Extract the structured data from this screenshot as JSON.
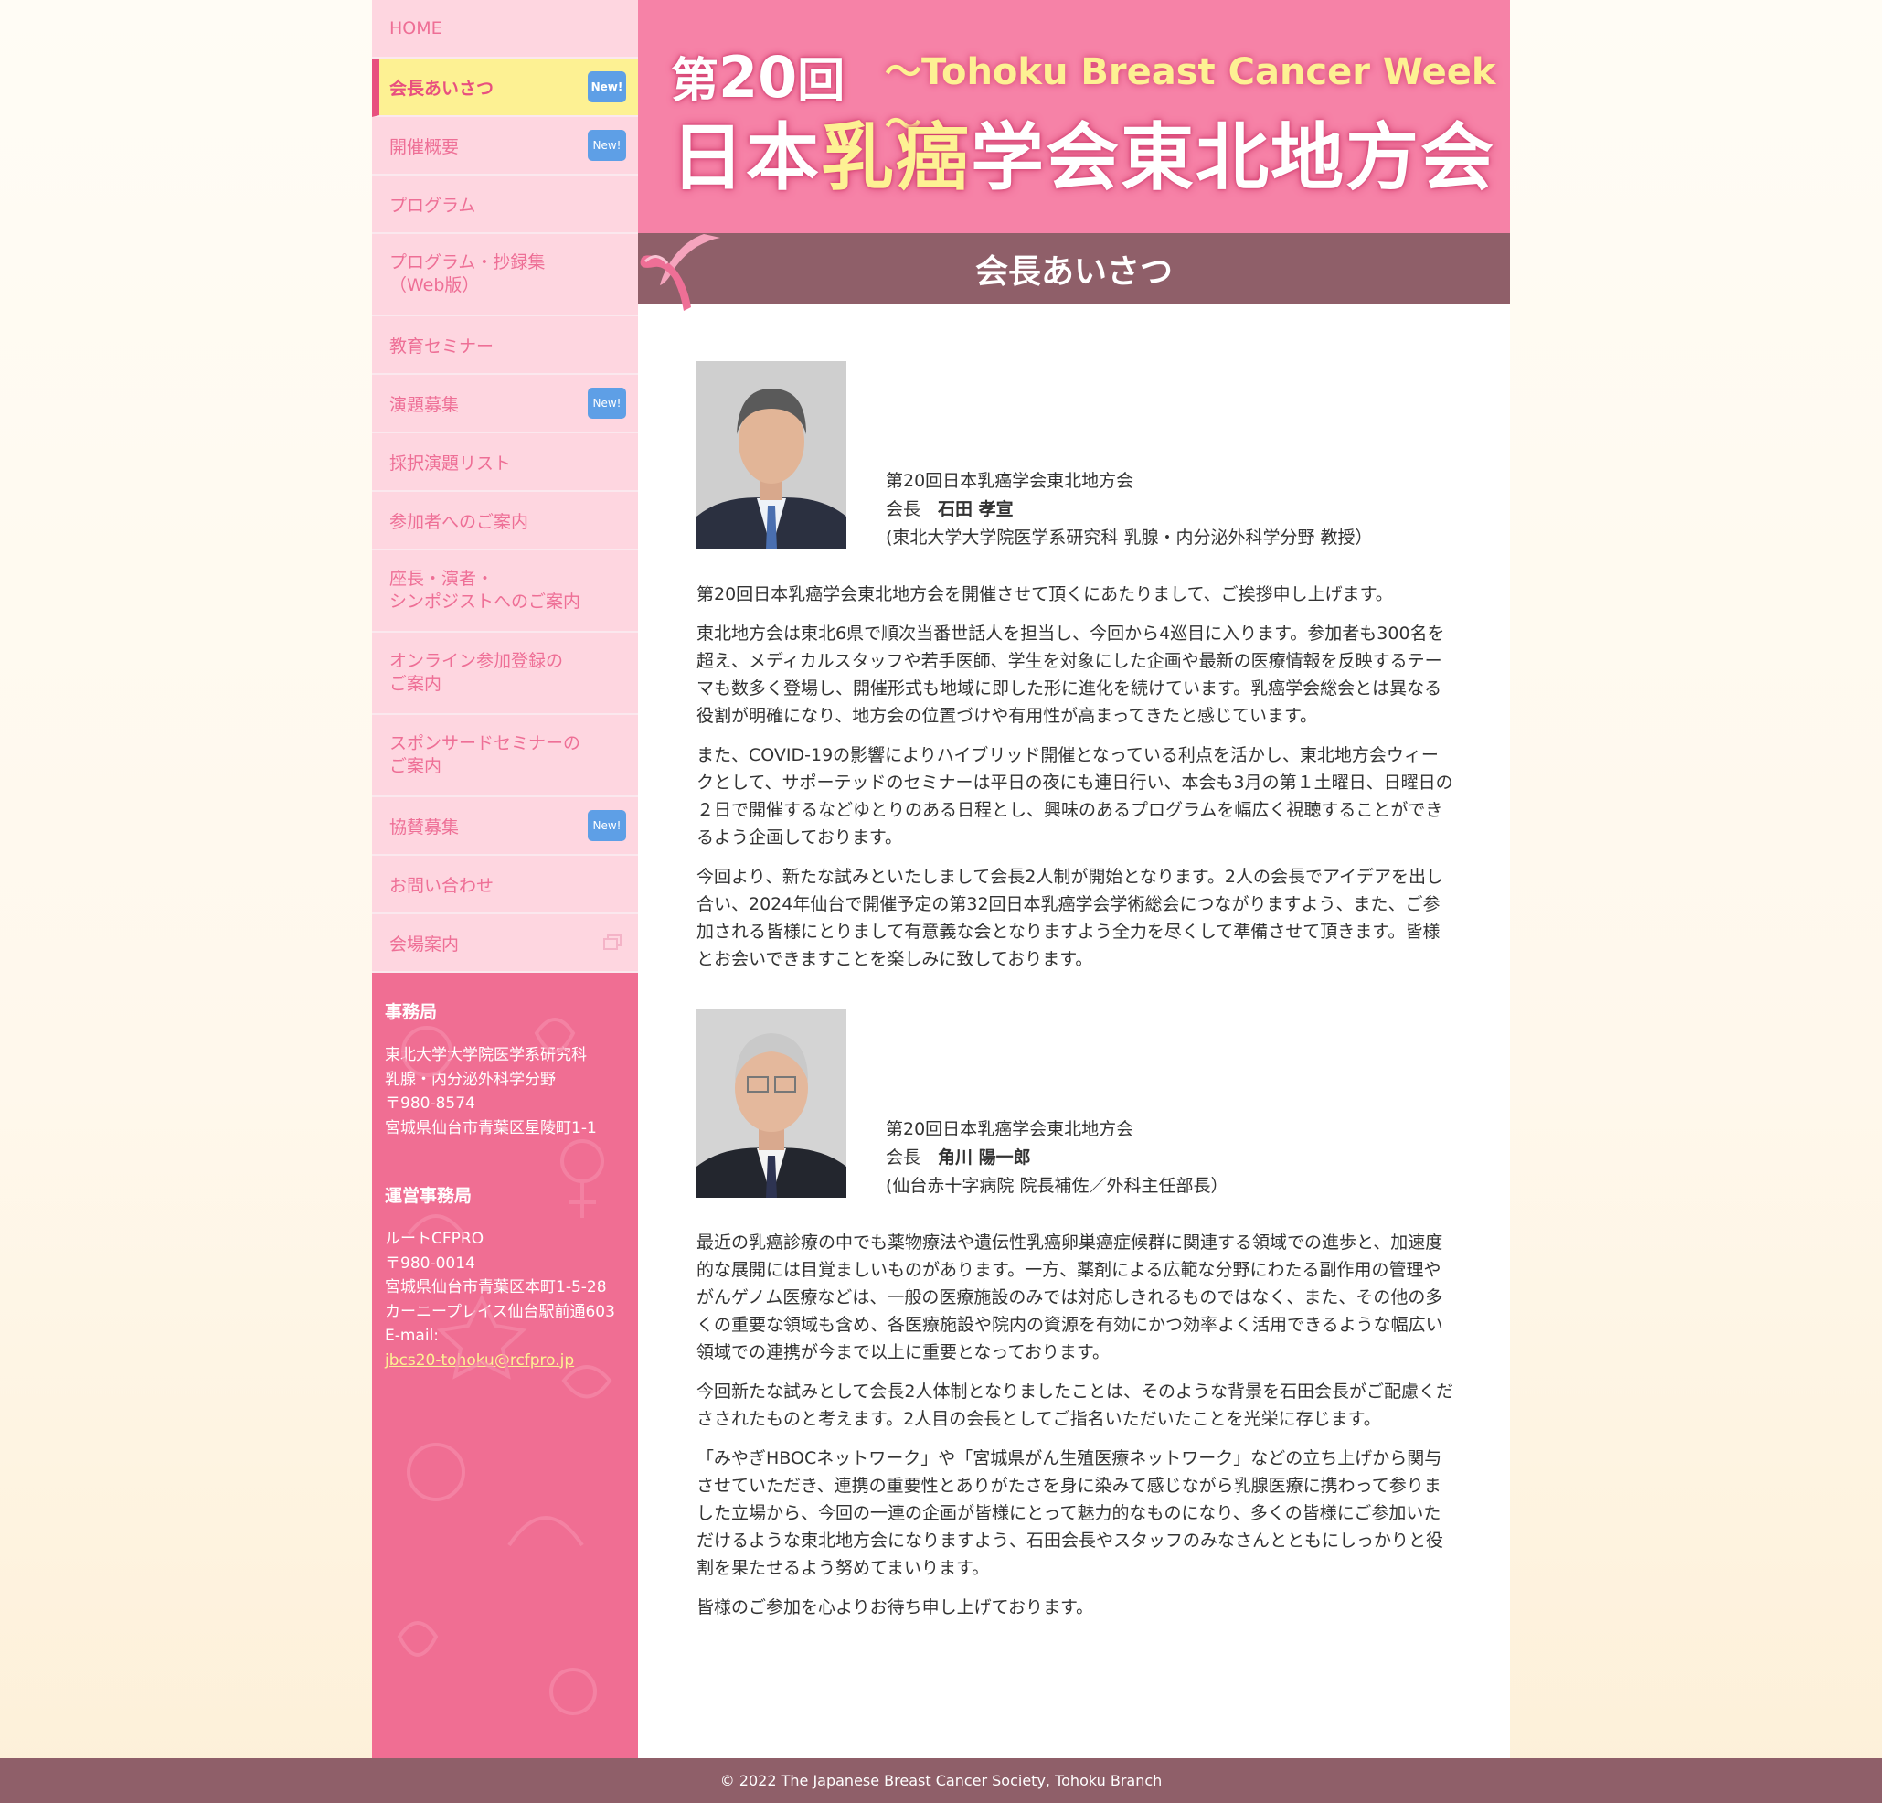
{
  "nav": [
    {
      "label": "HOME",
      "badge": ""
    },
    {
      "label": "会長あいさつ",
      "badge": "New!",
      "active": true
    },
    {
      "label": "開催概要",
      "badge": "New!"
    },
    {
      "label": "プログラム",
      "badge": ""
    },
    {
      "label": "プログラム・抄録集\n（Web版）",
      "badge": ""
    },
    {
      "label": "教育セミナー",
      "badge": ""
    },
    {
      "label": "演題募集",
      "badge": "New!"
    },
    {
      "label": "採択演題リスト",
      "badge": ""
    },
    {
      "label": "参加者へのご案内",
      "badge": ""
    },
    {
      "label": "座長・演者・\nシンポジストへのご案内",
      "badge": ""
    },
    {
      "label": "オンライン参加登録の\nご案内",
      "badge": ""
    },
    {
      "label": "スポンサードセミナーの\nご案内",
      "badge": ""
    },
    {
      "label": "協賛募集",
      "badge": "New!"
    },
    {
      "label": "お問い合わせ",
      "badge": ""
    },
    {
      "label": "会場案内",
      "badge": "",
      "external": true
    }
  ],
  "office": {
    "title": "事務局",
    "lines": [
      "東北大学大学院医学系研究科",
      "乳腺・内分泌外科学分野",
      "〒980-8574",
      "宮城県仙台市青葉区星陵町1-1"
    ]
  },
  "ops_office": {
    "title": "運営事務局",
    "lines": [
      "ルートCFPRO",
      "〒980-0014",
      "宮城県仙台市青葉区本町1-5-28",
      "カーニープレイス仙台駅前通603",
      "E-mail:"
    ],
    "email": "jbcs20-tohoku@rcfpro.jp"
  },
  "banner": {
    "dai": "第",
    "num": "20",
    "kai": "回",
    "week": "～Tohoku Breast Cancer Week～",
    "org_pre": "日本",
    "org_hl": "乳癌",
    "org_post": "学会東北地方会"
  },
  "page_title": "会長あいさつ",
  "president1": {
    "org": "第20回日本乳癌学会東北地方会",
    "role": "会長　",
    "name": "石田 孝宣",
    "affil": "(東北大学大学院医学系研究科 乳腺・内分泌外科学分野 教授）",
    "paras": [
      "第20回日本乳癌学会東北地方会を開催させて頂くにあたりまして、ご挨拶申し上げます。",
      "東北地方会は東北6県で順次当番世話人を担当し、今回から4巡目に入ります。参加者も300名を超え、メディカルスタッフや若手医師、学生を対象にした企画や最新の医療情報を反映するテーマも数多く登場し、開催形式も地域に即した形に進化を続けています。乳癌学会総会とは異なる役割が明確になり、地方会の位置づけや有用性が高まってきたと感じています。",
      "また、COVID-19の影響によりハイブリッド開催となっている利点を活かし、東北地方会ウィークとして、サポーテッドのセミナーは平日の夜にも連日行い、本会も3月の第１土曜日、日曜日の２日で開催するなどゆとりのある日程とし、興味のあるプログラムを幅広く視聴することができるよう企画しております。",
      "今回より、新たな試みといたしまして会長2人制が開始となります。2人の会長でアイデアを出し合い、2024年仙台で開催予定の第32回日本乳癌学会学術総会につながりますよう、また、ご参加される皆様にとりまして有意義な会となりますよう全力を尽くして準備させて頂きます。皆様とお会いできますことを楽しみに致しております。"
    ]
  },
  "president2": {
    "org": "第20回日本乳癌学会東北地方会",
    "role": "会長　",
    "name": "角川 陽一郎",
    "affil": "(仙台赤十字病院 院長補佐／外科主任部長）",
    "paras": [
      "最近の乳癌診療の中でも薬物療法や遺伝性乳癌卵巣癌症候群に関連する領域での進歩と、加速度的な展開には目覚ましいものがあります。一方、薬剤による広範な分野にわたる副作用の管理やがんゲノム医療などは、一般の医療施設のみでは対応しきれるものではなく、また、その他の多くの重要な領域も含め、各医療施設や院内の資源を有効にかつ効率よく活用できるような幅広い領域での連携が今まで以上に重要となっております。",
      "今回新たな試みとして会長2人体制となりましたことは、そのような背景を石田会長がご配慮くださされたものと考えます。2人目の会長としてご指名いただいたことを光栄に存じます。",
      "「みやぎHBOCネットワーク」や「宮城県がん生殖医療ネットワーク」などの立ち上げから関与させていただき、連携の重要性とありがたさを身に染みて感じながら乳腺医療に携わって参りました立場から、今回の一連の企画が皆様にとって魅力的なものになり、多くの皆様にご参加いただけるような東北地方会になりますよう、石田会長やスタッフのみなさんとともにしっかりと役割を果たせるよう努めてまいります。",
      "皆様のご参加を心よりお待ち申し上げております。"
    ]
  },
  "footer": "© 2022 The Japanese Breast Cancer Society, Tohoku Branch"
}
